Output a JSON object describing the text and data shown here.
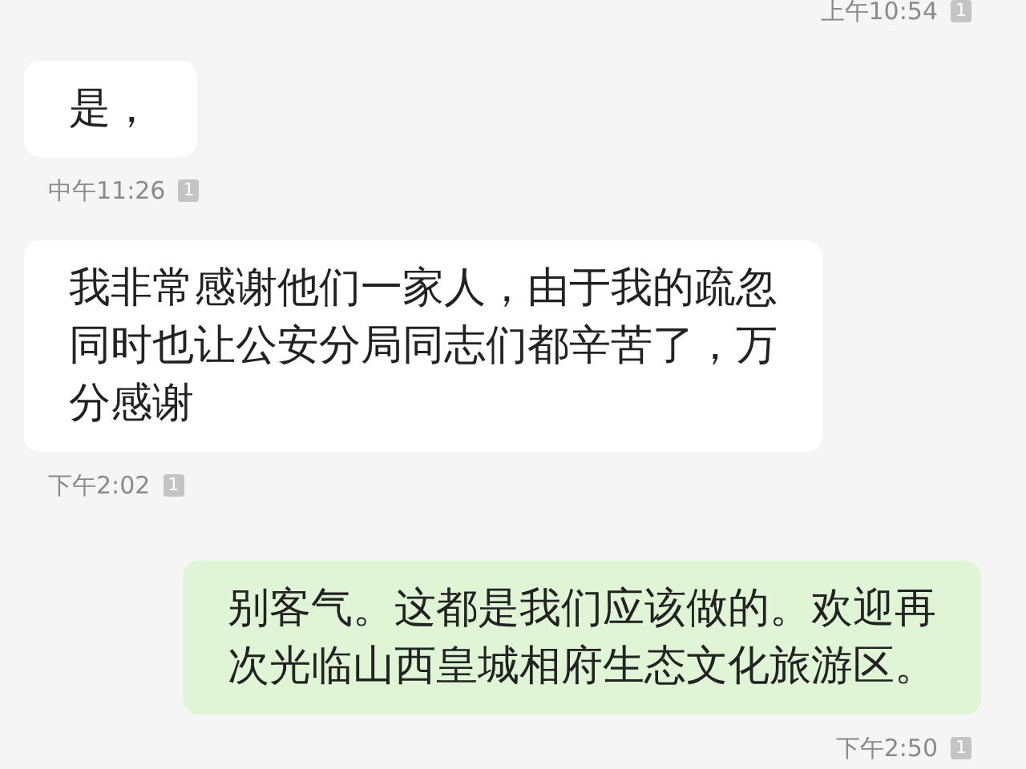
{
  "messages": [
    {
      "kind": "time",
      "outgoing": true,
      "time": "上午10:54",
      "receipt": "1"
    },
    {
      "kind": "bubble",
      "outgoing": false,
      "lines": [
        "是，"
      ],
      "time": "中午11:26",
      "receipt": "1"
    },
    {
      "kind": "bubble",
      "outgoing": false,
      "lines": [
        "我非常感谢他们一家人，由于我的疏忽",
        "同时也让公安分局同志们都辛苦了，万",
        "分感谢"
      ],
      "time": "下午2:02",
      "receipt": "1"
    },
    {
      "kind": "bubble",
      "outgoing": true,
      "lines": [
        "别客气。这都是我们应该做的。欢迎再",
        "次光临山西皇城相府生态文化旅游区。"
      ],
      "time": "下午2:50",
      "receipt": "1"
    }
  ]
}
